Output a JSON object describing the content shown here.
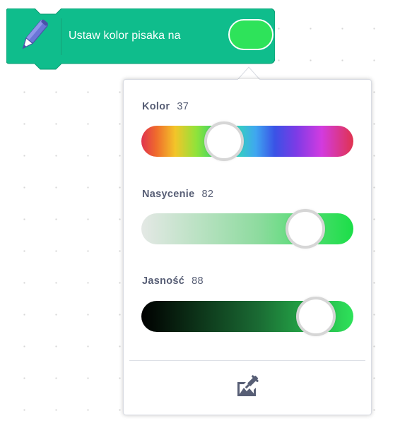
{
  "block": {
    "label": "Ustaw kolor pisaka na",
    "icon": "pen-icon",
    "color": "#0fbd8c",
    "swatch_color": "#2ee35a"
  },
  "color_picker": {
    "sliders": [
      {
        "id": "color",
        "label": "Kolor",
        "value": "37",
        "level": 0.37
      },
      {
        "id": "saturation",
        "label": "Nasycenie",
        "value": "82",
        "level": 0.82
      },
      {
        "id": "brightness",
        "label": "Jasność",
        "value": "88",
        "level": 0.88
      }
    ],
    "eyedropper_icon": "eyedropper-icon"
  }
}
